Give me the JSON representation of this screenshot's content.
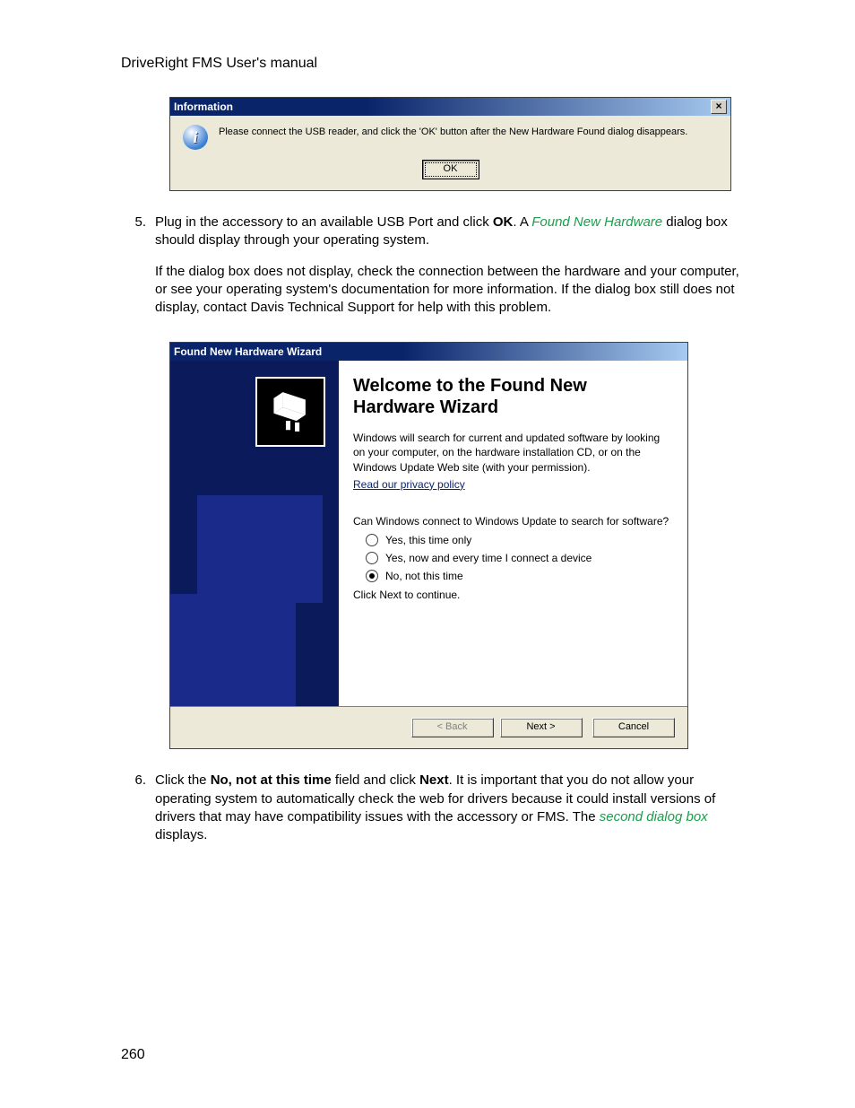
{
  "doc": {
    "header": "DriveRight FMS User's manual",
    "page_number": "260"
  },
  "info_dialog": {
    "title": "Information",
    "message": "Please connect the USB reader, and click the 'OK' button after the New Hardware Found dialog disappears.",
    "ok_label": "OK",
    "close_label": "×"
  },
  "step5": {
    "num": "5.",
    "p1_a": "Plug in the accessory to an available USB Port and click ",
    "p1_bold1": "OK",
    "p1_b": ". A ",
    "p1_green": "Found New Hardware",
    "p1_c": " dialog box should display through your operating system.",
    "p2": "If the dialog box does not display, check the connection between the hardware and your computer, or see your operating system's documentation for more information. If the dialog box still does not display, contact Davis Technical Support for help with this problem."
  },
  "wizard": {
    "title": "Found New Hardware Wizard",
    "heading": "Welcome to the Found New Hardware Wizard",
    "intro": "Windows will search for current and updated software by looking on your computer, on the hardware installation CD, or on the Windows Update Web site (with your permission).",
    "privacy_link": "Read our privacy policy",
    "question": "Can Windows connect to Windows Update to search for software?",
    "options": [
      {
        "label": "Yes, this time only",
        "selected": false
      },
      {
        "label": "Yes, now and every time I connect a device",
        "selected": false
      },
      {
        "label": "No, not this time",
        "selected": true
      }
    ],
    "continue_hint": "Click Next to continue.",
    "buttons": {
      "back": "< Back",
      "next": "Next >",
      "cancel": "Cancel"
    }
  },
  "step6": {
    "num": "6.",
    "a": "Click the ",
    "bold1": "No, not at this time",
    "b": " field and click ",
    "bold2": "Next",
    "c": ". It is important that you do not allow your operating system to automatically check the web for drivers because it could install versions of drivers that may have compatibility issues with the accessory or FMS. The ",
    "green": "second dialog box",
    "d": " displays."
  }
}
